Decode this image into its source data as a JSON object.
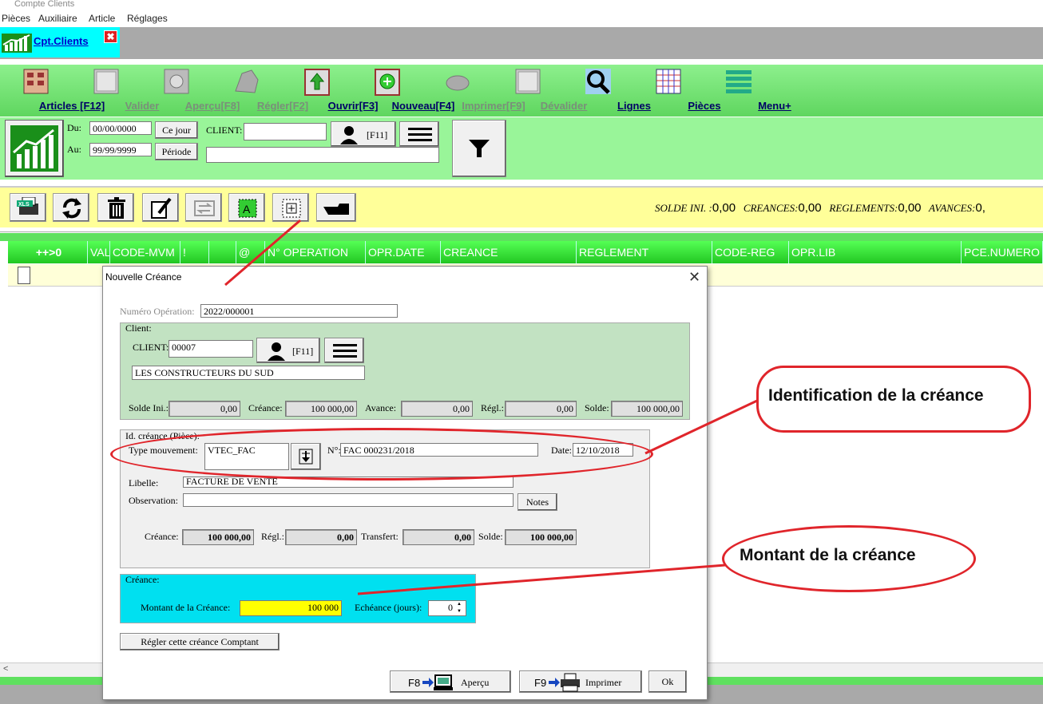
{
  "window": {
    "title": "Compte Clients"
  },
  "menu": [
    "Pièces",
    "Auxiliaire",
    "Article",
    "Réglages"
  ],
  "tab": {
    "label": "Cpt.Clients",
    "close": "✖"
  },
  "toolbar": [
    {
      "label": "Articles [F12]",
      "enabled": true
    },
    {
      "label": "Valider",
      "enabled": false
    },
    {
      "label": "Aperçu[F8]",
      "enabled": false
    },
    {
      "label": "Régler[F2]",
      "enabled": false
    },
    {
      "label": "Ouvrir[F3]",
      "enabled": true
    },
    {
      "label": "Nouveau[F4]",
      "enabled": true
    },
    {
      "label": "Imprimer[F9]",
      "enabled": false
    },
    {
      "label": "Dévalider",
      "enabled": false
    },
    {
      "label": "Lignes",
      "enabled": true
    },
    {
      "label": "Pièces",
      "enabled": true
    },
    {
      "label": "Menu+",
      "enabled": true
    }
  ],
  "filter": {
    "du_label": "Du:",
    "du_value": "00/00/0000",
    "au_label": "Au:",
    "au_value": "99/99/9999",
    "ce_jour": "Ce jour",
    "periode": "Période",
    "client_label": "CLIENT:",
    "client_value": "",
    "f11": "[F11]"
  },
  "totals": {
    "solde_ini_label": "SOLDE INI. :",
    "solde_ini": "0,00",
    "creances_label": "CREANCES:",
    "creances": "0,00",
    "reglements_label": "REGLEMENTS:",
    "reglements": "0,00",
    "avances_label": "AVANCES:",
    "avances": "0,"
  },
  "grid": {
    "columns": [
      "++>0",
      "VAL",
      "CODE-MVM",
      "!",
      "",
      "@",
      "N° OPERATION",
      "OPR.DATE",
      "CREANCE",
      "REGLEMENT",
      "CODE-REG",
      "OPR.LIB",
      "PCE.NUMERO"
    ]
  },
  "dialog": {
    "title": "Nouvelle Créance",
    "numero_label": "Numéro Opération:",
    "numero_value": "2022/000001",
    "client_group": "Client:",
    "client_label": "CLIENT:",
    "client_code": "00007",
    "client_f11": "[F11]",
    "client_name": "LES CONSTRUCTEURS DU SUD",
    "solde_ini_label": "Solde Ini.:",
    "solde_ini": "0,00",
    "creance_label": "Créance:",
    "creance": "100 000,00",
    "avance_label": "Avance:",
    "avance": "0,00",
    "regl_label": "Régl.:",
    "regl": "0,00",
    "solde_label": "Solde:",
    "solde": "100 000,00",
    "id_group": "Id. créance (Pièce):",
    "type_label": "Type mouvement:",
    "type_value": "VTEC_FAC",
    "num_label": "N°:",
    "num_value": "FAC 000231/2018",
    "date_label": "Date:",
    "date_value": "12/10/2018",
    "libelle_label": "Libelle:",
    "libelle_value": "FACTURE DE VENTE",
    "obs_label": "Observation:",
    "obs_value": "",
    "notes": "Notes",
    "b_creance_label": "Créance:",
    "b_creance": "100 000,00",
    "b_regl_label": "Régl.:",
    "b_regl": "0,00",
    "b_transfert_label": "Transfert:",
    "b_transfert": "0,00",
    "b_solde_label": "Solde:",
    "b_solde": "100 000,00",
    "creance_group": "Créance:",
    "montant_label": "Montant de la Créance:",
    "montant_value": "100 000",
    "echeance_label": "Echéance (jours):",
    "echeance_value": "0",
    "regler_button": "Régler cette créance Comptant",
    "apercu_key": "F8",
    "apercu": "Aperçu",
    "imprimer_key": "F9",
    "imprimer": "Imprimer",
    "ok": "Ok"
  },
  "annotations": {
    "identification": "Identification de la créance",
    "montant": "Montant de la créance"
  },
  "colors": {
    "toolbar_green": "#5fd65f",
    "tab_cyan": "#00ffff",
    "highlight_yellow": "#ffff00",
    "callout_red": "#e0252b"
  }
}
